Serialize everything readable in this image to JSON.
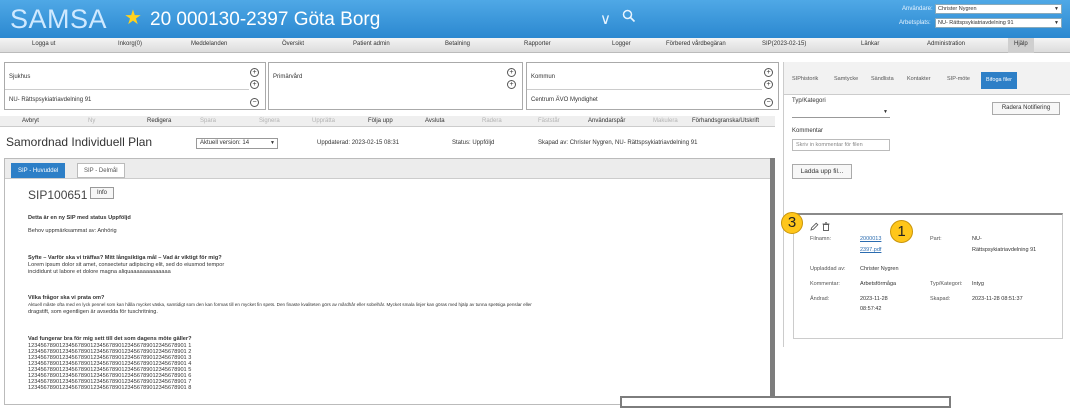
{
  "header": {
    "app_name": "SAMSA",
    "patient": "20 000130-2397 Göta Borg",
    "user_label": "Användare:",
    "user_value": "Christer Nygren",
    "workplace_label": "Arbetsplats:",
    "workplace_value": "NU- Rättspsykiatriavdelning 91",
    "colors": {
      "bar": "#2b88d0",
      "logo": "#cfe9ff",
      "star": "#ffd21e"
    }
  },
  "menu": [
    "Logga ut",
    "Inkorg(0)",
    "Meddelanden",
    "Översikt",
    "Patient admin",
    "Betalning",
    "Rapporter",
    "Logger",
    "Förbered vårdbegäran",
    "SIP(2023-02-15)",
    "Länkar",
    "Administration",
    "Hjälp"
  ],
  "context": {
    "sjukhus_label": "Sjukhus",
    "sjukhus_value": "NU- Rättspsykiatriavdelning 91",
    "primarvard_label": "Primärvård",
    "kommun_label": "Kommun",
    "kommun_value": "Centrum ÄVO Myndighet"
  },
  "actions": [
    "Avbryt",
    "Ny",
    "Redigera",
    "Spara",
    "Signera",
    "Upprätta",
    "Följa upp",
    "Avsluta",
    "Radera",
    "Fäststår",
    "Användarspår",
    "Makulera",
    "Förhandsgranska/Utskrift"
  ],
  "plan": {
    "title": "Samordnad Individuell Plan",
    "version": "Aktuell version: 14",
    "updated": "Uppdaterad: 2023-02-15 08:31",
    "status": "Status: Uppföljd",
    "created_by": "Skapad av: Christer Nygren, NU- Rättspsykiatriavdelning 91"
  },
  "main_tabs": [
    "SIP - Huvuddel",
    "SIP - Delmål"
  ],
  "sip": {
    "id": "SIP100651",
    "info_label": "Info",
    "lines": [
      "Detta är en ny SIP med status Uppföljd",
      "Behov uppmärksammat av: Anhörig",
      "Syfte – Varför ska vi träffas? Mitt långsiktiga mål – Vad är viktigt för mig?",
      "Lorem ipsum dolor sit amet, consectetur adipiscing elit, sed do eiusmod tempor",
      "incididunt ut labore et dolore magna aliquaaaaaaaaaaaaa",
      "Vilka frågor ska vi prata om?",
      "Aktuell måste ofta med en lyck pennel som kan hålla mycket väska, samtidigt som den kan formas till en mycket fin spets. Den finaste kvaliteten görs av mårdhår eller sobelhår. Mycket smala linjer kan göras med hjälp av tunna spetsiga penslar eller",
      "dragstift, som egentligen är avsedda för tuschritning.",
      "Vad fungerar bra för mig sett till det som dagens möte gäller?",
      "123456789012345678901234567890123456789012345678901 1",
      "123456789012345678901234567890123456789012345678901 2",
      "123456789012345678901234567890123456789012345678901 3",
      "123456789012345678901234567890123456789012345678901 4",
      "123456789012345678901234567890123456789012345678901 5",
      "123456789012345678901234567890123456789012345678901 6",
      "123456789012345678901234567890123456789012345678901 7",
      "123456789012345678901234567890123456789012345678901 8"
    ]
  },
  "right": {
    "tabs": [
      "SIPhistorik",
      "Samtycke",
      "Sändlista",
      "Kontakter",
      "SIP-möte",
      "Bifoga filer"
    ],
    "type_label": "Typ/Kategori",
    "reset_button": "Radera Notifiering",
    "comment_label": "Kommentar",
    "comment_placeholder": "Skriv in kommentar för filen",
    "upload_button": "Ladda upp fil...",
    "file": {
      "name_label": "Filnamn:",
      "name_value_1": "2000013",
      "name_value_2": "2397.pdf",
      "part_label": "Part:",
      "part_value_1": "NU-",
      "part_value_2": "Rättspsykiatriavdelning 91",
      "uploaded_by_label": "Uppladdad av:",
      "uploaded_by_value": "Christer Nygren",
      "comment_label": "Kommentar:",
      "comment_value": "Arbetsförmåga",
      "type_label": "Typ/Kategori:",
      "type_value": "Intyg",
      "changed_label": "Ändrad:",
      "changed_value_1": "2023-11-28",
      "changed_value_2": "08:57:42",
      "created_label": "Skapad:",
      "created_value": "2023-11-28 08:51:37"
    }
  },
  "badges": {
    "one": "1",
    "three": "3"
  }
}
